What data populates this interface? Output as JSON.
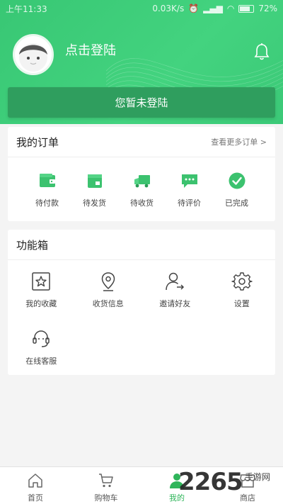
{
  "status_bar": {
    "time": "上午11:33",
    "speed": "0.03K/s",
    "battery": "72%"
  },
  "profile": {
    "login_text": "点击登陆",
    "not_logged_in": "您暂未登陆"
  },
  "orders": {
    "title": "我的订单",
    "more": "查看更多订单 >",
    "items": [
      {
        "label": "待付款",
        "icon": "wallet-icon"
      },
      {
        "label": "待发货",
        "icon": "box-icon"
      },
      {
        "label": "待收货",
        "icon": "truck-icon"
      },
      {
        "label": "待评价",
        "icon": "chat-icon"
      },
      {
        "label": "已完成",
        "icon": "check-circle-icon"
      }
    ]
  },
  "toolbox": {
    "title": "功能箱",
    "items": [
      {
        "label": "我的收藏",
        "icon": "star-icon"
      },
      {
        "label": "收货信息",
        "icon": "location-pin-icon"
      },
      {
        "label": "邀请好友",
        "icon": "invite-user-icon"
      },
      {
        "label": "设置",
        "icon": "gear-icon"
      },
      {
        "label": "在线客服",
        "icon": "headset-icon"
      }
    ]
  },
  "tabbar": {
    "items": [
      {
        "label": "首页",
        "icon": "home-icon",
        "active": false
      },
      {
        "label": "购物车",
        "icon": "cart-icon",
        "active": false
      },
      {
        "label": "我的",
        "icon": "user-icon",
        "active": true
      },
      {
        "label": "商店",
        "icon": "store-icon",
        "active": false
      }
    ]
  },
  "watermark": {
    "text": "2265",
    "sub": "手游网"
  },
  "colors": {
    "primary": "#3ccb78",
    "accent_dark": "#2f9e5e",
    "tab_active": "#2fb55a"
  }
}
